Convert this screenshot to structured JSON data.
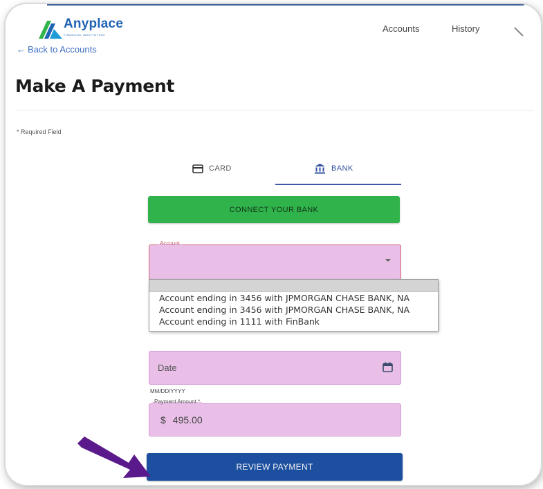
{
  "header": {
    "logo_text": "Anyplace",
    "logo_subtext": "FINANCIAL INSTITUTION",
    "nav": [
      {
        "label": "Accounts"
      },
      {
        "label": "History"
      }
    ],
    "back_link": "Back to Accounts"
  },
  "page": {
    "title": "Make A Payment",
    "required_note": "* Required Field"
  },
  "tabs": [
    {
      "label": "CARD",
      "icon": "credit-card-icon",
      "selected": false
    },
    {
      "label": "BANK",
      "icon": "bank-icon",
      "selected": true
    }
  ],
  "connect_button": "CONNECT YOUR BANK",
  "account_select": {
    "label": "Account",
    "value": "",
    "options": [
      "",
      "Account ending in 3456 with JPMORGAN CHASE BANK, NA",
      "Account ending in 3456 with JPMORGAN CHASE BANK, NA",
      "Account ending in 1111 with FinBank"
    ]
  },
  "date_field": {
    "placeholder": "Date",
    "hint": "MM/DD/YYYY",
    "icon": "calendar-icon"
  },
  "amount_field": {
    "label": "Payment Amount *",
    "currency": "$",
    "value": "495.00"
  },
  "review_button": "REVIEW PAYMENT",
  "colors": {
    "brand_blue": "#1f63b4",
    "connect_green": "#2fb34a",
    "review_blue": "#1c4fa0",
    "field_highlight": "#e9bfe8",
    "arrow_purple": "#5b1a8c"
  }
}
